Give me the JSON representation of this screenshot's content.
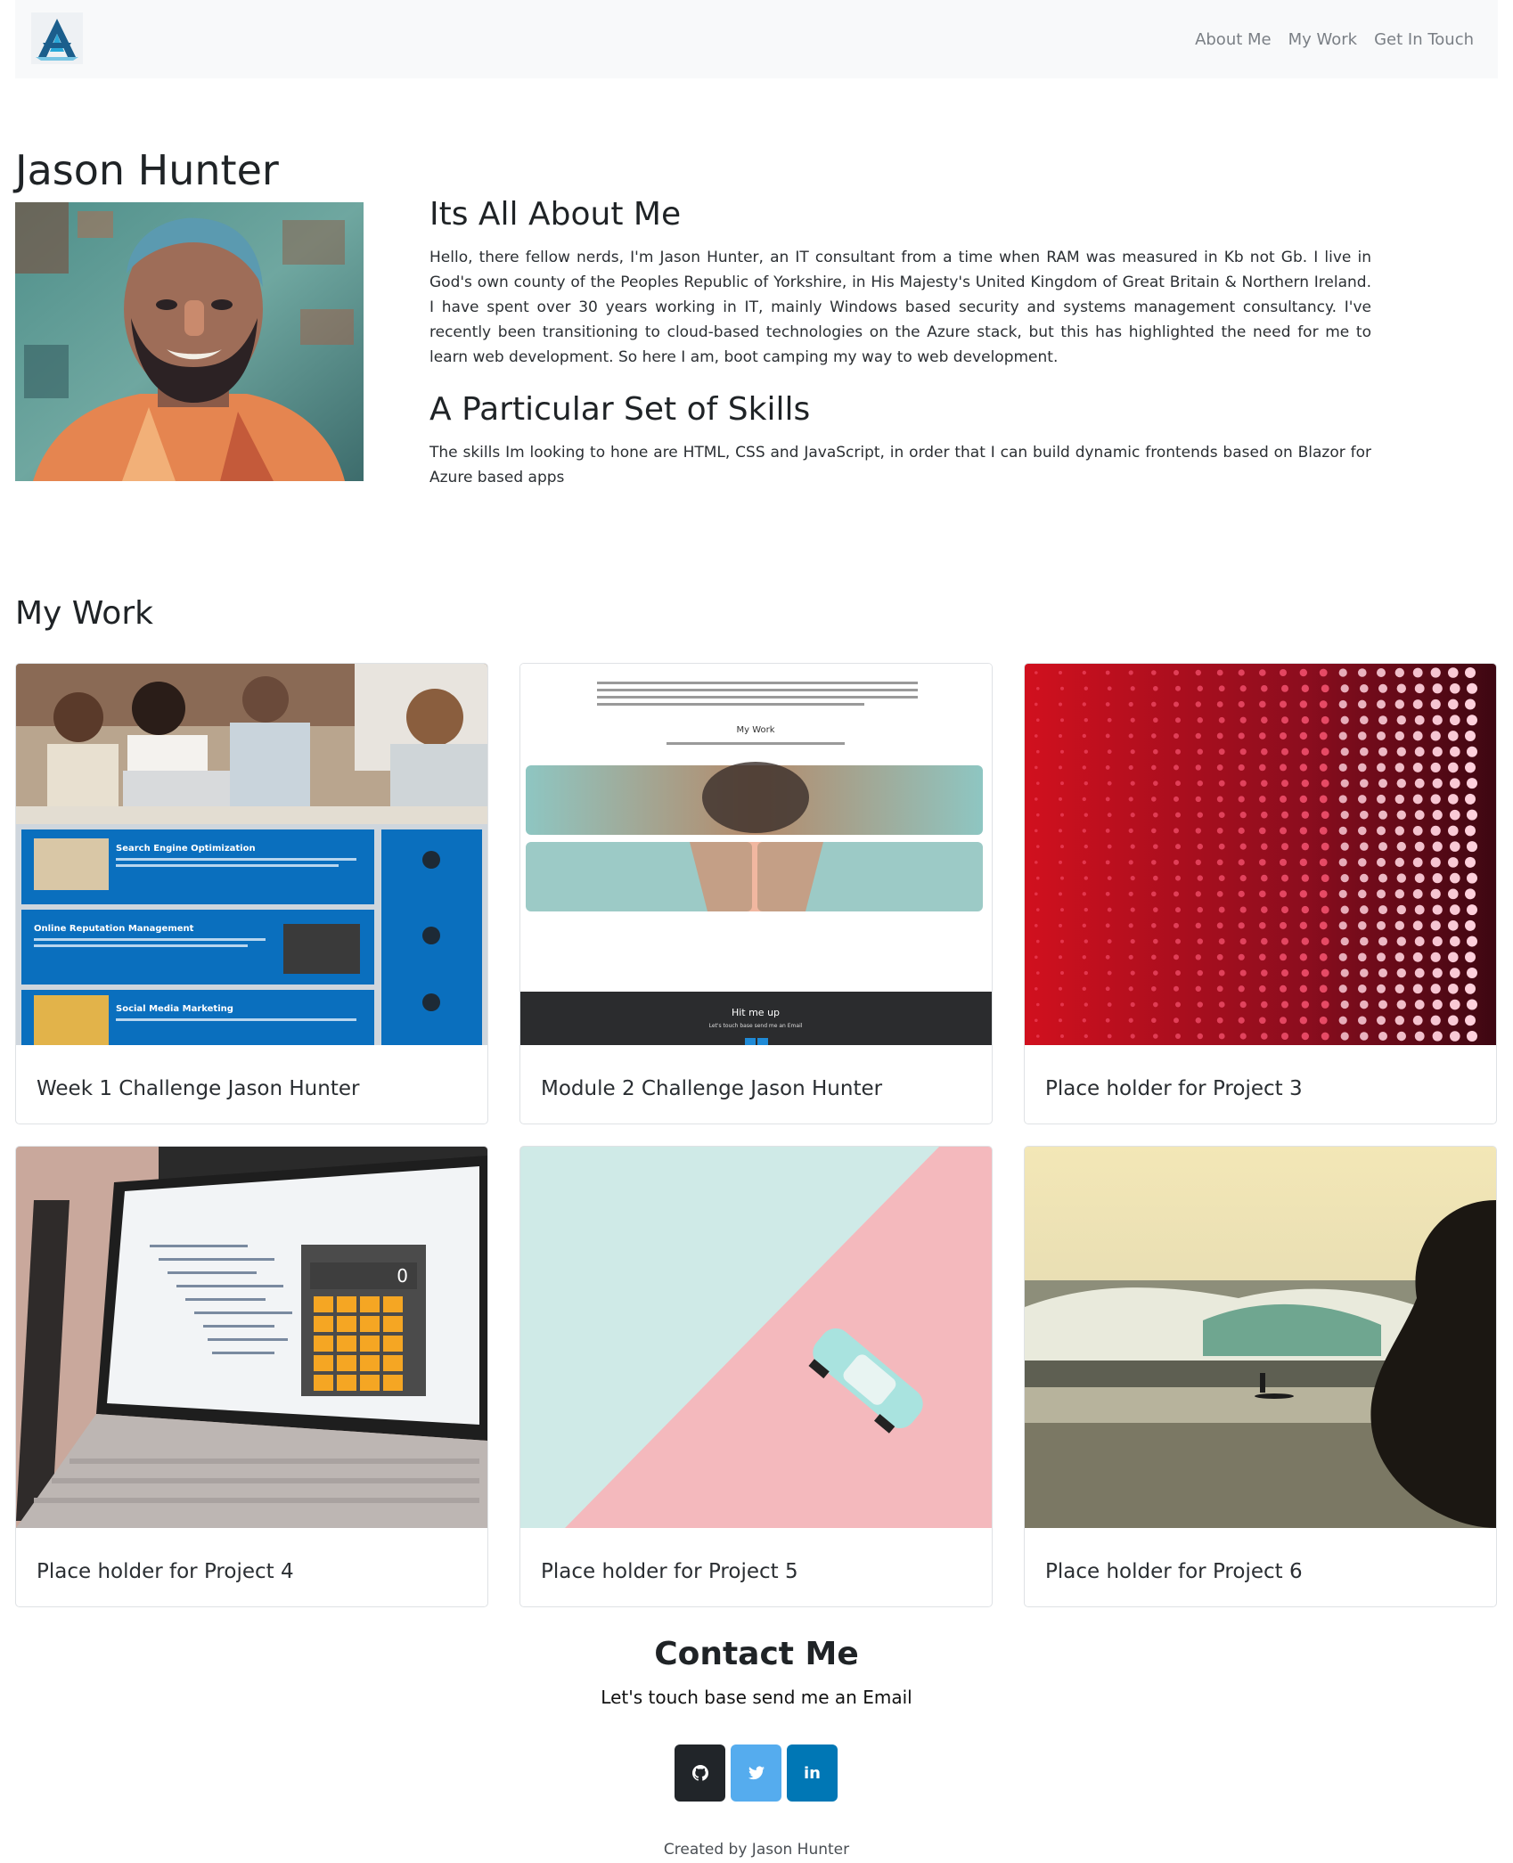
{
  "nav": {
    "logo_icon": "stylized-a-logo-icon",
    "links": [
      {
        "label": "About Me"
      },
      {
        "label": "My Work"
      },
      {
        "label": "Get In Touch"
      }
    ]
  },
  "about": {
    "name": "Jason Hunter",
    "heading": "Its All About Me",
    "paragraph": "Hello, there fellow nerds, I'm Jason Hunter, an IT consultant from a time when RAM was measured in Kb not Gb. I live in God's own county of the Peoples Republic of Yorkshire, in His Majesty's United Kingdom of Great Britain & Northern Ireland. I have spent over 30 years working in IT, mainly Windows based security and systems management consultancy. I've recently been transitioning to cloud-based technologies on the Azure stack, but this has highlighted the need for me to learn web development. So here I am, boot camping my way to web development.",
    "skills_heading": "A Particular Set of Skills",
    "skills_paragraph": "The skills Im looking to hone are HTML, CSS and JavaScript, in order that I can build dynamic frontends based on Blazor for Azure based apps"
  },
  "work": {
    "heading": "My Work",
    "projects": [
      {
        "title": "Week 1 Challenge Jason Hunter"
      },
      {
        "title": "Module 2 Challenge Jason Hunter"
      },
      {
        "title": "Place holder for Project 3"
      },
      {
        "title": "Place holder for Project 4"
      },
      {
        "title": "Place holder for Project 5"
      },
      {
        "title": "Place holder for Project 6"
      }
    ],
    "thumb1": {
      "items": [
        "Search Engine Optimization",
        "Online Reputation Management",
        "Social Media Marketing"
      ]
    },
    "thumb2": {
      "heading": "My Work",
      "footer_title": "Hit me up",
      "footer_sub": "Let's touch base send me an Email"
    },
    "thumb4": {
      "display": "0"
    }
  },
  "contact": {
    "heading": "Contact Me",
    "subtitle": "Let's touch base send me an Email",
    "social": [
      {
        "icon": "github-icon",
        "color": "#212529"
      },
      {
        "icon": "twitter-icon",
        "color": "#55acee"
      },
      {
        "icon": "linkedin-icon",
        "color": "#0077b5"
      }
    ]
  },
  "footer": {
    "text": "Created by Jason Hunter"
  }
}
